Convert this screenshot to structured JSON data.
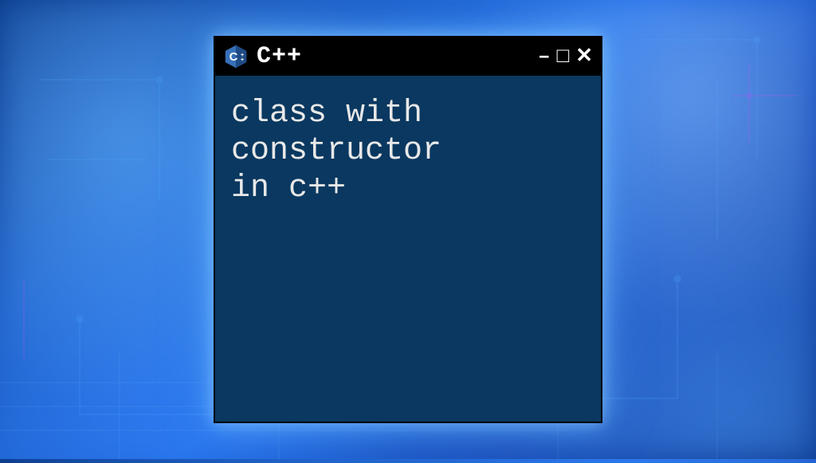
{
  "window": {
    "title": "C++",
    "icon_name": "cpp-icon",
    "controls": {
      "minimize": "–",
      "maximize": "□",
      "close": "✕"
    }
  },
  "body": {
    "text": "class with\nconstructor\nin c++"
  },
  "colors": {
    "window_bg": "#0a3860",
    "titlebar_bg": "#000000",
    "text": "#e8e8e8",
    "glow": "#64b4ff"
  }
}
